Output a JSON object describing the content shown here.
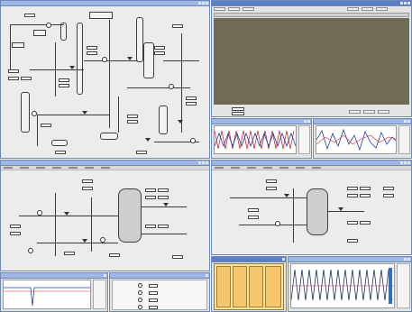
{
  "screen": {
    "windows": {
      "main_overview": {
        "title": ""
      },
      "alarm_viewer": {
        "title": ""
      },
      "trend_left": {
        "title": ""
      },
      "trend_right": {
        "title": ""
      },
      "reactor_left": {
        "title": ""
      },
      "reactor_right": {
        "title": ""
      },
      "bottom_trend": {
        "title": ""
      },
      "bottom_list": {
        "title": ""
      },
      "bottom_panel": {
        "title": ""
      },
      "bottom_big_trend": {
        "title": ""
      }
    }
  },
  "colors": {
    "window_title": "#9db7e6",
    "window_border": "#6f87b5",
    "alarm_area": "#6f6b55",
    "trend_red": "#d32f2f",
    "trend_blue": "#1e3fa8",
    "trend_navy": "#17336f",
    "yellow_panel": "#fbe3a0"
  },
  "icons": [
    "minimize-icon",
    "maximize-icon",
    "close-icon",
    "control-valve-icon",
    "controller-bubble-icon"
  ]
}
